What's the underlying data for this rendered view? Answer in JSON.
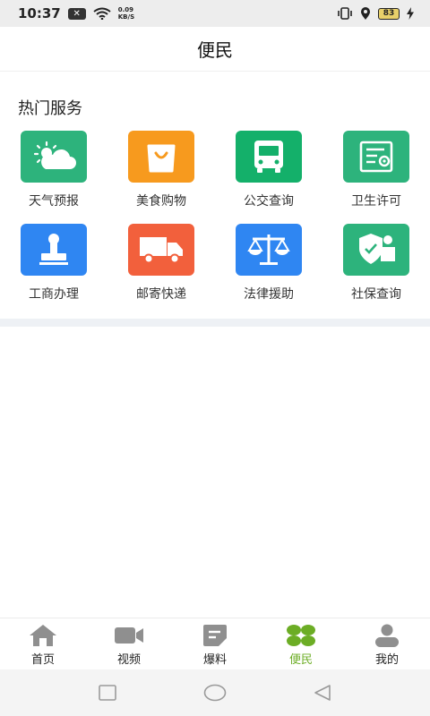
{
  "status_bar": {
    "time": "10:37",
    "speed_value": "0.09",
    "speed_unit": "KB/S",
    "battery": "83"
  },
  "header": {
    "title": "便民"
  },
  "hot_services": {
    "title": "热门服务",
    "items": [
      {
        "label": "天气预报",
        "icon": "weather-icon",
        "color": "#2db37c"
      },
      {
        "label": "美食购物",
        "icon": "shopping-bag-icon",
        "color": "#f79a1e"
      },
      {
        "label": "公交查询",
        "icon": "bus-icon",
        "color": "#14b06a"
      },
      {
        "label": "卫生许可",
        "icon": "certificate-icon",
        "color": "#2db37c"
      },
      {
        "label": "工商办理",
        "icon": "stamp-icon",
        "color": "#2f86f2"
      },
      {
        "label": "邮寄快递",
        "icon": "truck-icon",
        "color": "#f2603c"
      },
      {
        "label": "法律援助",
        "icon": "scales-icon",
        "color": "#2f86f2"
      },
      {
        "label": "社保查询",
        "icon": "shield-person-icon",
        "color": "#2db37c"
      }
    ]
  },
  "tabbar": {
    "items": [
      {
        "label": "首页",
        "icon": "home-icon"
      },
      {
        "label": "视频",
        "icon": "video-camera-icon"
      },
      {
        "label": "爆料",
        "icon": "report-icon"
      },
      {
        "label": "便民",
        "icon": "clover-icon",
        "active": true
      },
      {
        "label": "我的",
        "icon": "user-icon"
      }
    ],
    "active_color": "#6cad25"
  }
}
